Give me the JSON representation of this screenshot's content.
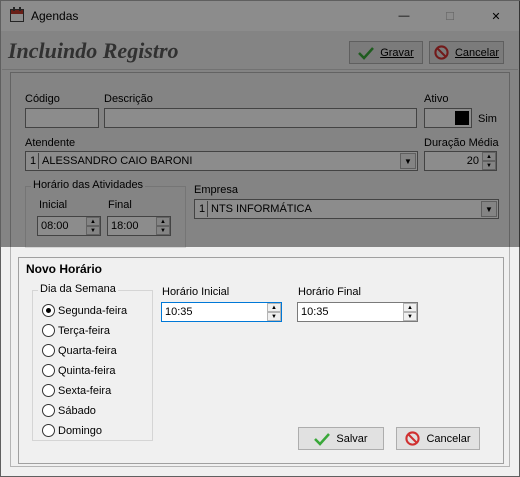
{
  "window": {
    "title": "Agendas",
    "minimize_glyph": "—",
    "maximize_glyph": "☐",
    "close_glyph": "✕"
  },
  "header": {
    "title": "Incluindo Registro",
    "save_label": "Gravar",
    "cancel_label": "Cancelar"
  },
  "form": {
    "codigo_label": "Código",
    "codigo_value": "",
    "descricao_label": "Descrição",
    "descricao_value": "",
    "ativo_label": "Ativo",
    "ativo_value": "Sim",
    "atendente_label": "Atendente",
    "atendente_index": "1",
    "atendente_value": "ALESSANDRO CAIO BARONI",
    "duracao_label": "Duração Média",
    "duracao_value": "20",
    "horario_group": "Horário das Atividades",
    "inicial_label": "Inicial",
    "inicial_value": "08:00",
    "final_label": "Final",
    "final_value": "18:00",
    "empresa_label": "Empresa",
    "empresa_index": "1",
    "empresa_value": "NTS INFORMÁTICA"
  },
  "dialog": {
    "title": "Novo Horário",
    "dia_group": "Dia da Semana",
    "days": [
      "Segunda-feira",
      "Terça-feira",
      "Quarta-feira",
      "Quinta-feira",
      "Sexta-feira",
      "Sábado",
      "Domingo"
    ],
    "selected_day": "Segunda-feira",
    "horario_inicial_label": "Horário Inicial",
    "horario_inicial_value": "10:35",
    "horario_final_label": "Horário Final",
    "horario_final_value": "10:35",
    "save_label": "Salvar",
    "cancel_label": "Cancelar"
  },
  "colors": {
    "accent_focus": "#0078d7",
    "check_green": "#3aa83a",
    "cancel_red": "#d03030",
    "title_gray": "#595959"
  },
  "icons": {
    "app": "calendar-icon",
    "save": "checkmark-icon",
    "cancel": "no-entry-icon"
  }
}
